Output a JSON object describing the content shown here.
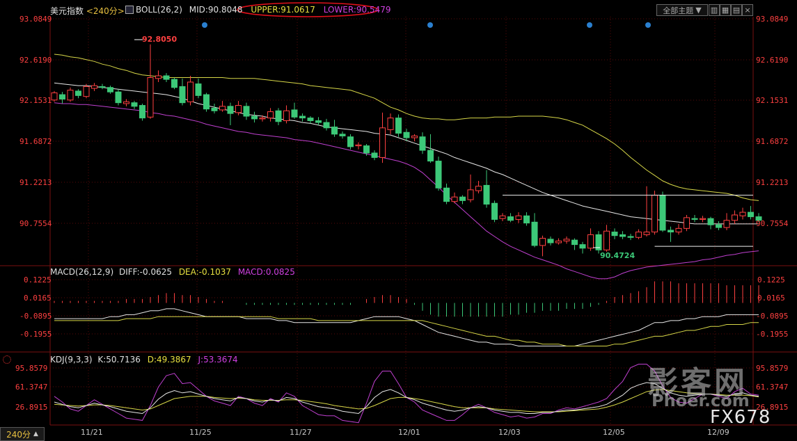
{
  "header": {
    "title": "美元指数",
    "period": "<240分>",
    "boll_label": "BOLL(26,2)",
    "mid": "MID:90.8048",
    "upper": "UPPER:91.0617",
    "lower": "LOWER:90.5479",
    "topic_button": "全部主题",
    "close_glyph": "×"
  },
  "price_panel": {
    "ticks": [
      "93.0849",
      "92.6190",
      "92.1531",
      "91.6872",
      "91.2213",
      "90.7554"
    ],
    "high_annotation": "92.8050",
    "low_annotation": "90.4724"
  },
  "macd_panel": {
    "label": "MACD(26,12,9)",
    "diff": "DIFF:-0.0625",
    "dea": "DEA:-0.1037",
    "macd": "MACD:0.0825",
    "ticks": [
      "0.1225",
      "0.0165",
      "-0.0895",
      "-0.1955"
    ]
  },
  "kdj_panel": {
    "label": "KDJ(9,3,3)",
    "k": "K:50.7136",
    "d": "D:49.3867",
    "j": "J:53.3674",
    "ticks": [
      "95.8579",
      "61.3747",
      "26.8915"
    ]
  },
  "x_axis": {
    "period_tab": "240分",
    "dates": [
      "11/21",
      "11/25",
      "11/27",
      "12/01",
      "12/03",
      "12/05",
      "12/09"
    ]
  },
  "watermark": {
    "brand_cn": "影客网",
    "brand_en": "Phoer.com",
    "brand_code": "FX678"
  },
  "colors": {
    "up": "#ff4040",
    "down": "#3cc878",
    "upper": "#d8d848",
    "mid": "#e8e8e8",
    "lower": "#c040d0",
    "tick_red": "#ff4040"
  },
  "chart_data": {
    "type": "candlestick",
    "symbol": "美元指数",
    "interval": "240分",
    "indicators": {
      "boll": {
        "mid": 90.8048,
        "upper": 91.0617,
        "lower": 90.5479
      },
      "macd": {
        "diff": -0.0625,
        "dea": -0.1037,
        "macd": 0.0825
      },
      "kdj": {
        "k": 50.7136,
        "d": 49.3867,
        "j": 53.3674
      }
    },
    "price_range": [
      90.35,
      93.0849
    ],
    "high": 92.805,
    "low": 90.4724,
    "candles": [
      [
        92.18,
        92.26,
        92.28,
        92.16
      ],
      [
        92.24,
        92.19,
        92.27,
        92.14
      ],
      [
        92.18,
        92.29,
        92.32,
        92.16
      ],
      [
        92.28,
        92.23,
        92.3,
        92.2
      ],
      [
        92.22,
        92.33,
        92.36,
        92.2
      ],
      [
        92.31,
        92.34,
        92.37,
        92.28
      ],
      [
        92.33,
        92.32,
        92.36,
        92.3
      ],
      [
        92.32,
        92.27,
        92.34,
        92.25
      ],
      [
        92.27,
        92.15,
        92.3,
        92.12
      ],
      [
        92.14,
        92.16,
        92.19,
        92.11
      ],
      [
        92.15,
        92.11,
        92.17,
        92.08
      ],
      [
        92.12,
        91.98,
        92.14,
        91.95
      ],
      [
        91.99,
        92.43,
        92.8,
        91.97
      ],
      [
        92.42,
        92.45,
        92.51,
        92.38
      ],
      [
        92.45,
        92.41,
        92.48,
        92.38
      ],
      [
        92.41,
        92.32,
        92.43,
        92.3
      ],
      [
        92.33,
        92.15,
        92.42,
        92.12
      ],
      [
        92.16,
        92.38,
        92.45,
        92.12
      ],
      [
        92.36,
        92.23,
        92.42,
        92.2
      ],
      [
        92.24,
        92.08,
        92.26,
        92.05
      ],
      [
        92.09,
        92.06,
        92.14,
        92.03
      ],
      [
        92.07,
        92.11,
        92.17,
        92.05
      ],
      [
        92.11,
        92.03,
        92.15,
        91.9
      ],
      [
        92.04,
        92.12,
        92.17,
        92.01
      ],
      [
        92.11,
        92.0,
        92.15,
        91.96
      ],
      [
        92.0,
        91.97,
        92.05,
        91.93
      ],
      [
        91.97,
        91.98,
        92.01,
        91.94
      ],
      [
        91.98,
        92.05,
        92.09,
        91.94
      ],
      [
        92.06,
        91.94,
        92.09,
        91.9
      ],
      [
        91.95,
        92.06,
        92.12,
        91.92
      ],
      [
        92.07,
        91.99,
        92.15,
        91.97
      ],
      [
        92.0,
        91.98,
        92.03,
        91.94
      ],
      [
        91.98,
        91.95,
        92.0,
        91.92
      ],
      [
        91.95,
        91.93,
        91.99,
        91.9
      ],
      [
        91.93,
        91.87,
        91.97,
        91.84
      ],
      [
        91.88,
        91.8,
        91.96,
        91.77
      ],
      [
        91.8,
        91.78,
        91.83,
        91.75
      ],
      [
        91.77,
        91.66,
        91.8,
        91.63
      ],
      [
        91.67,
        91.68,
        91.71,
        91.63
      ],
      [
        91.67,
        91.59,
        91.69,
        91.56
      ],
      [
        91.59,
        91.54,
        91.62,
        91.51
      ],
      [
        91.54,
        91.87,
        92.04,
        91.48
      ],
      [
        91.85,
        91.98,
        92.03,
        91.8
      ],
      [
        91.98,
        91.81,
        92.02,
        91.77
      ],
      [
        91.82,
        91.76,
        91.86,
        91.72
      ],
      [
        91.76,
        91.78,
        91.8,
        91.72
      ],
      [
        91.77,
        91.62,
        91.82,
        91.58
      ],
      [
        91.62,
        91.5,
        91.8,
        91.48
      ],
      [
        91.5,
        91.2,
        91.55,
        91.17
      ],
      [
        91.2,
        91.05,
        91.25,
        91.02
      ],
      [
        91.05,
        91.1,
        91.15,
        91.03
      ],
      [
        91.1,
        91.06,
        91.12,
        91.02
      ],
      [
        91.07,
        91.18,
        91.35,
        91.04
      ],
      [
        91.17,
        91.22,
        91.28,
        91.14
      ],
      [
        91.23,
        91.02,
        91.4,
        90.98
      ],
      [
        91.03,
        90.85,
        91.06,
        90.82
      ],
      [
        90.86,
        90.89,
        90.92,
        90.83
      ],
      [
        90.88,
        90.84,
        90.92,
        90.82
      ],
      [
        90.85,
        90.89,
        90.93,
        90.81
      ],
      [
        90.89,
        90.81,
        90.93,
        90.78
      ],
      [
        90.82,
        90.56,
        90.92,
        90.54
      ],
      [
        90.56,
        90.64,
        90.67,
        90.44
      ],
      [
        90.63,
        90.59,
        90.66,
        90.56
      ],
      [
        90.59,
        90.61,
        90.64,
        90.57
      ],
      [
        90.61,
        90.63,
        90.66,
        90.58
      ],
      [
        90.62,
        90.57,
        90.64,
        90.51
      ],
      [
        90.57,
        90.53,
        90.6,
        90.47
      ],
      [
        90.53,
        90.68,
        90.75,
        90.5
      ],
      [
        90.68,
        90.51,
        90.72,
        90.47
      ],
      [
        90.51,
        90.72,
        90.79,
        90.49
      ],
      [
        90.71,
        90.67,
        90.75,
        90.63
      ],
      [
        90.68,
        90.66,
        90.72,
        90.63
      ],
      [
        90.66,
        90.65,
        90.69,
        90.62
      ],
      [
        90.65,
        90.71,
        90.74,
        90.63
      ],
      [
        90.68,
        90.71,
        91.22,
        90.66
      ],
      [
        90.71,
        91.12,
        91.17,
        90.68
      ],
      [
        91.12,
        90.73,
        91.16,
        90.71
      ],
      [
        90.73,
        90.71,
        90.77,
        90.6
      ],
      [
        90.71,
        90.75,
        90.8,
        90.68
      ],
      [
        90.75,
        90.87,
        90.9,
        90.72
      ],
      [
        90.86,
        90.85,
        90.9,
        90.82
      ],
      [
        90.85,
        90.86,
        90.89,
        90.82
      ],
      [
        90.86,
        90.79,
        90.88,
        90.74
      ],
      [
        90.79,
        90.76,
        90.83,
        90.73
      ],
      [
        90.76,
        90.84,
        90.92,
        90.73
      ],
      [
        90.84,
        90.9,
        90.95,
        90.8
      ],
      [
        90.89,
        90.93,
        90.98,
        90.85
      ],
      [
        90.93,
        90.88,
        91.0,
        90.85
      ],
      [
        90.88,
        90.84,
        90.92,
        90.82
      ]
    ],
    "boll_upper": [
      92.69,
      92.68,
      92.66,
      92.65,
      92.63,
      92.61,
      92.58,
      92.56,
      92.53,
      92.51,
      92.48,
      92.46,
      92.45,
      92.44,
      92.43,
      92.43,
      92.43,
      92.43,
      92.43,
      92.43,
      92.43,
      92.43,
      92.42,
      92.42,
      92.42,
      92.42,
      92.41,
      92.4,
      92.39,
      92.38,
      92.37,
      92.36,
      92.34,
      92.33,
      92.32,
      92.31,
      92.3,
      92.29,
      92.26,
      92.23,
      92.2,
      92.15,
      92.1,
      92.07,
      92.03,
      92.0,
      91.98,
      91.97,
      91.97,
      91.96,
      91.96,
      91.97,
      91.98,
      91.98,
      91.98,
      91.99,
      91.99,
      91.99,
      92.0,
      92.0,
      92.0,
      92.0,
      91.99,
      91.98,
      91.96,
      91.93,
      91.9,
      91.85,
      91.8,
      91.75,
      91.69,
      91.62,
      91.54,
      91.47,
      91.4,
      91.34,
      91.28,
      91.24,
      91.21,
      91.19,
      91.18,
      91.17,
      91.16,
      91.15,
      91.14,
      91.12,
      91.09,
      91.07,
      91.06
    ],
    "boll_mid": [
      92.37,
      92.36,
      92.35,
      92.34,
      92.34,
      92.33,
      92.32,
      92.31,
      92.3,
      92.29,
      92.28,
      92.27,
      92.26,
      92.25,
      92.24,
      92.22,
      92.2,
      92.17,
      92.14,
      92.12,
      92.1,
      92.08,
      92.06,
      92.04,
      92.02,
      92.01,
      92.0,
      91.98,
      91.97,
      91.96,
      91.95,
      91.93,
      91.92,
      91.9,
      91.88,
      91.87,
      91.86,
      91.85,
      91.84,
      91.83,
      91.81,
      91.8,
      91.79,
      91.76,
      91.73,
      91.7,
      91.67,
      91.64,
      91.61,
      91.58,
      91.54,
      91.51,
      91.48,
      91.45,
      91.42,
      91.38,
      91.35,
      91.31,
      91.27,
      91.23,
      91.19,
      91.15,
      91.12,
      91.09,
      91.06,
      91.03,
      91.0,
      90.98,
      90.96,
      90.94,
      90.92,
      90.9,
      90.88,
      90.87,
      90.86,
      90.85,
      90.84,
      90.83,
      90.82,
      90.81,
      90.8,
      90.8,
      90.8,
      90.8,
      90.8,
      90.8,
      90.8,
      90.8,
      90.8
    ],
    "boll_lower": [
      92.15,
      92.14,
      92.14,
      92.13,
      92.13,
      92.12,
      92.11,
      92.1,
      92.09,
      92.08,
      92.07,
      92.06,
      92.04,
      92.03,
      92.01,
      92.0,
      91.98,
      91.96,
      91.94,
      91.91,
      91.89,
      91.87,
      91.85,
      91.83,
      91.82,
      91.8,
      91.79,
      91.78,
      91.77,
      91.76,
      91.74,
      91.73,
      91.72,
      91.7,
      91.68,
      91.66,
      91.64,
      91.62,
      91.6,
      91.58,
      91.56,
      91.54,
      91.52,
      91.5,
      91.47,
      91.43,
      91.37,
      91.29,
      91.21,
      91.12,
      91.04,
      90.96,
      90.88,
      90.8,
      90.72,
      90.66,
      90.6,
      90.55,
      90.51,
      90.47,
      90.43,
      90.4,
      90.37,
      90.34,
      90.3,
      90.27,
      90.24,
      90.21,
      90.19,
      90.19,
      90.21,
      90.25,
      90.28,
      90.3,
      90.32,
      90.33,
      90.34,
      90.35,
      90.36,
      90.37,
      90.38,
      90.4,
      90.41,
      90.43,
      90.45,
      90.46,
      90.48,
      90.49,
      90.5
    ],
    "resistance_level": 91.12,
    "support_level": 90.55,
    "macd_range": [
      -0.25,
      0.14
    ],
    "macd_hist": [
      0.01,
      0.01,
      0.01,
      0.01,
      0.01,
      0.01,
      0.01,
      0.01,
      0.01,
      0.02,
      0.02,
      0.02,
      0.03,
      0.04,
      0.05,
      0.05,
      0.04,
      0.04,
      0.03,
      0.02,
      0.01,
      0.01,
      0.0,
      0.0,
      -0.01,
      -0.01,
      -0.01,
      -0.01,
      -0.01,
      -0.01,
      -0.01,
      -0.01,
      -0.01,
      -0.01,
      -0.01,
      -0.01,
      -0.01,
      -0.01,
      0.0,
      0.02,
      0.03,
      0.04,
      0.04,
      0.03,
      0.02,
      -0.01,
      -0.04,
      -0.06,
      -0.07,
      -0.07,
      -0.07,
      -0.07,
      -0.07,
      -0.07,
      -0.07,
      -0.07,
      -0.07,
      -0.06,
      -0.06,
      -0.05,
      -0.05,
      -0.04,
      -0.04,
      -0.04,
      -0.03,
      -0.03,
      -0.03,
      -0.02,
      -0.01,
      0.01,
      0.03,
      0.04,
      0.05,
      0.06,
      0.08,
      0.11,
      0.11,
      0.11,
      0.1,
      0.1,
      0.1,
      0.1,
      0.1,
      0.1,
      0.09,
      0.09,
      0.09,
      0.09,
      0.09
    ],
    "macd_diff": [
      -0.08,
      -0.08,
      -0.08,
      -0.08,
      -0.08,
      -0.08,
      -0.08,
      -0.07,
      -0.07,
      -0.06,
      -0.06,
      -0.05,
      -0.04,
      -0.04,
      -0.03,
      -0.03,
      -0.04,
      -0.05,
      -0.06,
      -0.07,
      -0.07,
      -0.07,
      -0.07,
      -0.07,
      -0.08,
      -0.08,
      -0.08,
      -0.08,
      -0.09,
      -0.09,
      -0.1,
      -0.1,
      -0.1,
      -0.1,
      -0.1,
      -0.1,
      -0.1,
      -0.1,
      -0.09,
      -0.08,
      -0.07,
      -0.07,
      -0.07,
      -0.07,
      -0.08,
      -0.09,
      -0.11,
      -0.13,
      -0.15,
      -0.16,
      -0.17,
      -0.18,
      -0.19,
      -0.2,
      -0.2,
      -0.21,
      -0.21,
      -0.21,
      -0.22,
      -0.22,
      -0.22,
      -0.22,
      -0.22,
      -0.22,
      -0.22,
      -0.22,
      -0.21,
      -0.2,
      -0.19,
      -0.18,
      -0.17,
      -0.16,
      -0.15,
      -0.14,
      -0.12,
      -0.1,
      -0.1,
      -0.09,
      -0.09,
      -0.08,
      -0.08,
      -0.07,
      -0.07,
      -0.07,
      -0.06,
      -0.06,
      -0.06,
      -0.06,
      -0.06
    ],
    "macd_dea": [
      -0.09,
      -0.09,
      -0.09,
      -0.09,
      -0.09,
      -0.09,
      -0.09,
      -0.09,
      -0.09,
      -0.08,
      -0.08,
      -0.08,
      -0.08,
      -0.07,
      -0.07,
      -0.07,
      -0.07,
      -0.07,
      -0.07,
      -0.07,
      -0.07,
      -0.07,
      -0.07,
      -0.07,
      -0.07,
      -0.07,
      -0.07,
      -0.07,
      -0.08,
      -0.08,
      -0.08,
      -0.08,
      -0.08,
      -0.09,
      -0.09,
      -0.09,
      -0.09,
      -0.09,
      -0.09,
      -0.09,
      -0.09,
      -0.09,
      -0.09,
      -0.09,
      -0.09,
      -0.09,
      -0.09,
      -0.1,
      -0.11,
      -0.12,
      -0.13,
      -0.14,
      -0.15,
      -0.16,
      -0.17,
      -0.17,
      -0.18,
      -0.19,
      -0.19,
      -0.2,
      -0.2,
      -0.21,
      -0.21,
      -0.21,
      -0.22,
      -0.22,
      -0.22,
      -0.22,
      -0.22,
      -0.22,
      -0.21,
      -0.21,
      -0.2,
      -0.19,
      -0.18,
      -0.17,
      -0.17,
      -0.16,
      -0.15,
      -0.14,
      -0.14,
      -0.13,
      -0.12,
      -0.12,
      -0.11,
      -0.11,
      -0.11,
      -0.1,
      -0.1
    ],
    "kdj_range": [
      0,
      120
    ],
    "kdj_k": [
      40,
      36,
      32,
      30,
      34,
      38,
      35,
      32,
      28,
      24,
      22,
      20,
      30,
      45,
      55,
      60,
      56,
      58,
      54,
      50,
      46,
      44,
      42,
      48,
      46,
      42,
      40,
      44,
      42,
      48,
      46,
      40,
      36,
      32,
      30,
      28,
      24,
      22,
      20,
      32,
      48,
      58,
      62,
      56,
      48,
      44,
      38,
      34,
      30,
      26,
      24,
      26,
      30,
      32,
      30,
      26,
      24,
      22,
      22,
      20,
      20,
      22,
      22,
      24,
      26,
      26,
      28,
      30,
      32,
      36,
      44,
      52,
      64,
      70,
      74,
      72,
      64,
      56,
      52,
      50,
      52,
      54,
      54,
      52,
      50,
      54,
      56,
      52,
      50
    ],
    "kdj_d": [
      36,
      35,
      34,
      33,
      34,
      35,
      35,
      34,
      32,
      30,
      28,
      26,
      28,
      34,
      40,
      46,
      48,
      50,
      50,
      50,
      48,
      47,
      46,
      47,
      46,
      44,
      43,
      43,
      43,
      44,
      44,
      43,
      41,
      39,
      37,
      34,
      32,
      30,
      28,
      29,
      34,
      40,
      46,
      48,
      48,
      46,
      44,
      41,
      38,
      35,
      32,
      30,
      30,
      30,
      30,
      28,
      27,
      26,
      25,
      24,
      23,
      23,
      23,
      23,
      24,
      25,
      26,
      27,
      28,
      31,
      35,
      40,
      46,
      52,
      58,
      61,
      62,
      60,
      58,
      56,
      55,
      54,
      54,
      53,
      52,
      52,
      52,
      51,
      49
    ],
    "kdj_j": [
      50,
      40,
      28,
      24,
      34,
      44,
      36,
      28,
      20,
      12,
      10,
      8,
      34,
      66,
      86,
      90,
      72,
      74,
      62,
      50,
      42,
      38,
      34,
      50,
      46,
      38,
      34,
      46,
      40,
      56,
      50,
      34,
      26,
      18,
      16,
      16,
      8,
      6,
      4,
      38,
      76,
      94,
      94,
      72,
      48,
      40,
      26,
      20,
      14,
      8,
      8,
      18,
      30,
      36,
      30,
      22,
      18,
      14,
      16,
      12,
      14,
      20,
      20,
      26,
      30,
      28,
      32,
      36,
      40,
      46,
      62,
      76,
      100,
      106,
      106,
      94,
      68,
      48,
      40,
      38,
      46,
      54,
      54,
      50,
      46,
      58,
      64,
      54,
      52
    ]
  }
}
